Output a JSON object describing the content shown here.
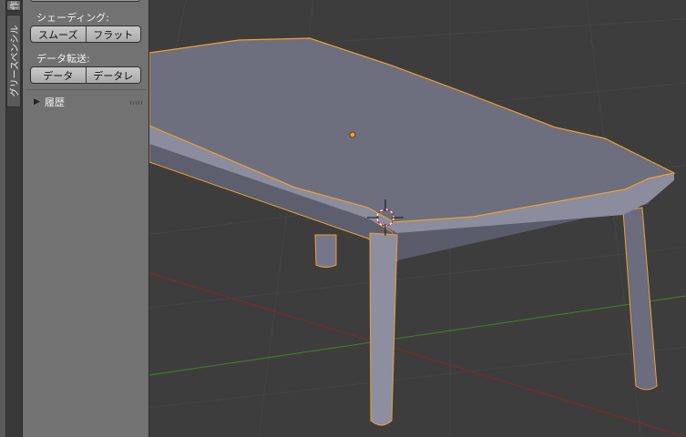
{
  "tabs": [
    {
      "label": "グリースペンシル"
    },
    {
      "label": "作"
    }
  ],
  "panel": {
    "shading_label": "シェーディング:",
    "shading_smooth": "スムーズ",
    "shading_flat": "フラット",
    "data_transfer_label": "データ転送:",
    "data_btn": "データ",
    "data_layout_btn": "データレ",
    "history_label": "履歴",
    "history_icon": "triangle-right-icon"
  },
  "viewport": {
    "grid_color": "#454545",
    "x_axis_color": "#7a2b2b",
    "y_axis_color": "#3f7a2b",
    "selection_outline": "#f0a030",
    "object_color": "#6d6e7e"
  }
}
